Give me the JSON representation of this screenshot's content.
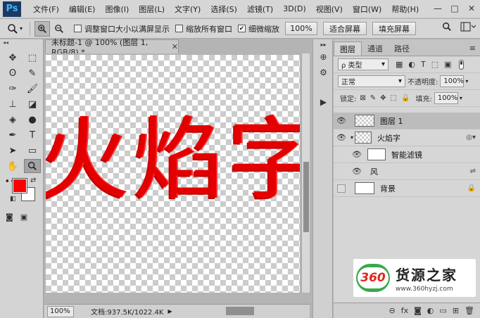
{
  "app": {
    "logo": "Ps",
    "menu": [
      "文件(F)",
      "编辑(E)",
      "图像(I)",
      "图层(L)",
      "文字(Y)",
      "选择(S)",
      "滤镜(T)",
      "3D(D)",
      "视图(V)",
      "窗口(W)",
      "帮助(H)"
    ],
    "window_controls": [
      "—",
      "□",
      "✕"
    ]
  },
  "options": {
    "tool_icon": "zoom-icon",
    "zoom_in_icon": "zoom-in-icon",
    "zoom_out_icon": "zoom-out-icon",
    "checkboxes": [
      {
        "label": "调整窗口大小以满屏显示",
        "checked": false
      },
      {
        "label": "缩放所有窗口",
        "checked": false
      },
      {
        "label": "细微缩放",
        "checked": true
      }
    ],
    "zoom_percent": "100%",
    "fit_screen": "适合屏幕",
    "fill_screen": "填充屏幕"
  },
  "toolbar": {
    "tools": [
      {
        "name": "move-tool",
        "glyph": "✥"
      },
      {
        "name": "marquee-tool",
        "glyph": "⬚"
      },
      {
        "name": "lasso-tool",
        "glyph": "ʘ"
      },
      {
        "name": "quick-select-tool",
        "glyph": "✎"
      },
      {
        "name": "eyedropper-tool",
        "glyph": "✑"
      },
      {
        "name": "brush-tool",
        "glyph": "🖌"
      },
      {
        "name": "stamp-tool",
        "glyph": "⊥"
      },
      {
        "name": "eraser-tool",
        "glyph": "◪"
      },
      {
        "name": "bucket-tool",
        "glyph": "◈"
      },
      {
        "name": "dodge-tool",
        "glyph": "●"
      },
      {
        "name": "pen-tool",
        "glyph": "✒"
      },
      {
        "name": "type-tool",
        "glyph": "T"
      },
      {
        "name": "path-select-tool",
        "glyph": "➤"
      },
      {
        "name": "rectangle-tool",
        "glyph": "▭"
      },
      {
        "name": "hand-tool",
        "glyph": "✋"
      },
      {
        "name": "zoom-tool",
        "glyph": "🔍"
      },
      {
        "name": "more-tools",
        "glyph": "•••"
      }
    ],
    "foreground_color": "#ff0000",
    "background_color": "#ffffff"
  },
  "document": {
    "tab_title": "未标题-1 @ 100% (图层 1, RGB/8) *",
    "canvas_text": "火焰字",
    "zoom": "100%",
    "doc_info": "文档:937.5K/1022.4K"
  },
  "layers_panel": {
    "tabs": [
      "图层",
      "通道",
      "路径"
    ],
    "filter_label": "ρ 类型",
    "blend_mode": "正常",
    "opacity_label": "不透明度:",
    "opacity_value": "100%",
    "lock_label": "锁定:",
    "fill_label": "填充:",
    "fill_value": "100%",
    "layers": [
      {
        "name": "图层 1",
        "visible": true,
        "selected": true,
        "thumb": "checker",
        "indent": 0
      },
      {
        "name": "火焰字",
        "visible": true,
        "selected": false,
        "thumb": "checker",
        "indent": 0
      },
      {
        "name": "智能滤镜",
        "visible": true,
        "selected": false,
        "thumb": "white",
        "indent": 1
      },
      {
        "name": "风",
        "visible": true,
        "selected": false,
        "thumb": "none",
        "indent": 2
      },
      {
        "name": "背景",
        "visible": false,
        "selected": false,
        "thumb": "white",
        "indent": 0
      }
    ]
  },
  "watermark": {
    "logo_text": "360",
    "title": "货源之家",
    "url": "www.360hyzj.com"
  }
}
